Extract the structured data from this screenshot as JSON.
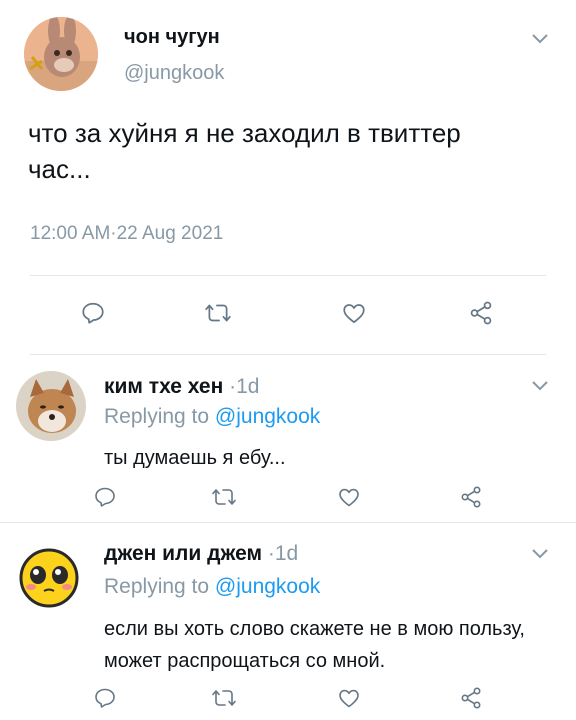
{
  "main_tweet": {
    "display_name": "чон чугун",
    "handle": "@jungkook",
    "text": "что за хуйня я не заходил в твиттер час...",
    "time": "12:00 AM",
    "separator": "·",
    "date": "22 Aug 2021"
  },
  "replies": [
    {
      "display_name": "ким тхе хен",
      "age": "·1d",
      "replying_prefix": "Replying to",
      "replying_handle": "@jungkook",
      "text": "ты думаешь я ебу..."
    },
    {
      "display_name": "джен или джем",
      "age": "·1d",
      "replying_prefix": "Replying to",
      "replying_handle": "@jungkook",
      "text": "если вы хоть слово скажете не в мою пользу, может распрощаться со мной."
    }
  ],
  "colors": {
    "grey": "#8899a6",
    "link_blue": "#1d9bf0",
    "divider": "#e1e8ed"
  },
  "icons": [
    "reply-icon",
    "retweet-icon",
    "like-icon",
    "share-icon",
    "chevron-down-icon"
  ]
}
